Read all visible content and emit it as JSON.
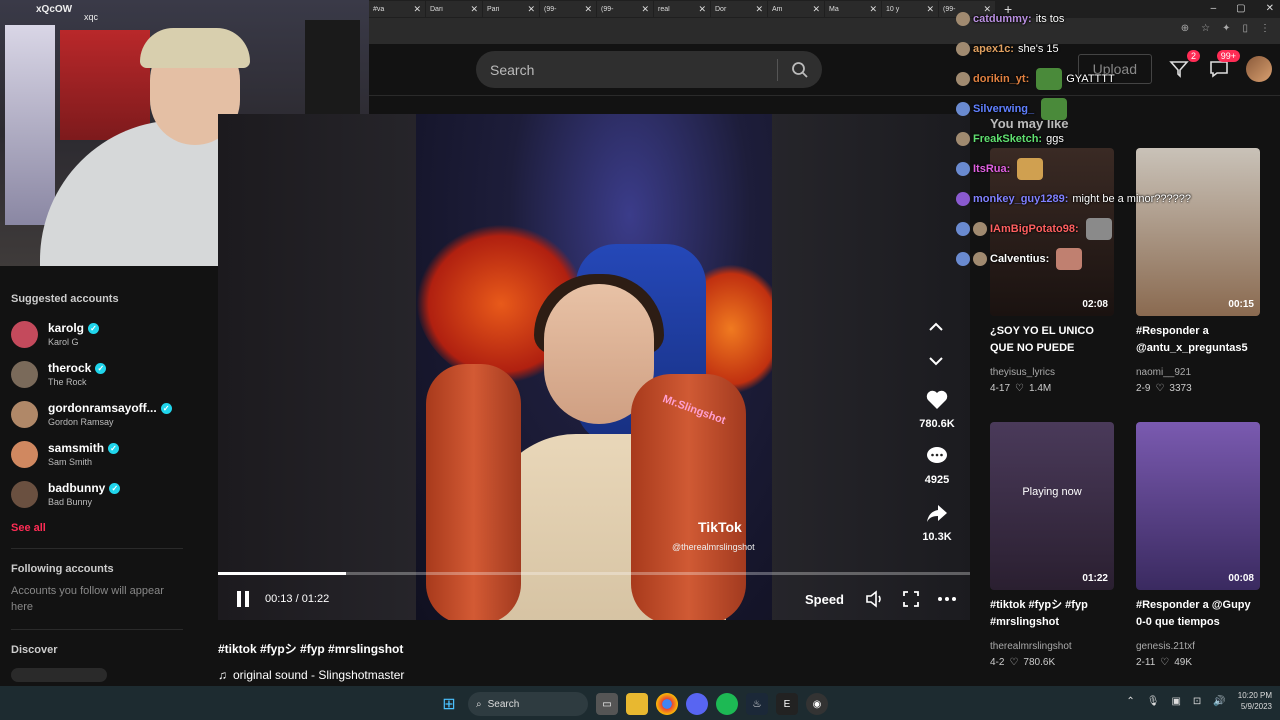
{
  "browser": {
    "tabs": [
      "#va",
      "Dari",
      "Pari",
      "(99-",
      "(99-",
      "real",
      "Dor",
      "Am",
      "Ma",
      "10 y",
      "(99-"
    ],
    "tab_close": "✕",
    "new_tab": "+",
    "window_controls": [
      "–",
      "▢",
      "✕"
    ]
  },
  "webcam": {
    "overlay_text_1": "xQcOW",
    "overlay_text_2": "xqc"
  },
  "header": {
    "search_placeholder": "Search",
    "upload_label": "Upload",
    "inbox_badge": "2",
    "messages_badge": "99+"
  },
  "sidebar": {
    "suggested_title": "Suggested accounts",
    "accounts": [
      {
        "handle": "karolg",
        "name": "Karol G",
        "color": "#c44a5c"
      },
      {
        "handle": "therock",
        "name": "The Rock",
        "color": "#7a6a5a"
      },
      {
        "handle": "gordonramsayoff...",
        "name": "Gordon Ramsay",
        "color": "#b08868"
      },
      {
        "handle": "samsmith",
        "name": "Sam Smith",
        "color": "#d08860"
      },
      {
        "handle": "badbunny",
        "name": "Bad Bunny",
        "color": "#6a5040"
      }
    ],
    "see_all": "See all",
    "following_title": "Following accounts",
    "following_text": "Accounts you follow will appear here",
    "discover_title": "Discover"
  },
  "video": {
    "watermark_name": "Mr.Slingshot",
    "tiktok_watermark": "TikTok",
    "watermark_handle": "@therealmrslingshot",
    "likes": "780.6K",
    "comments": "4925",
    "shares": "10.3K",
    "time": "00:13 / 01:22",
    "progress": 0.17,
    "speed_label": "Speed",
    "caption": "#tiktok #fypシ #fyp #mrslingshot",
    "sound": "original sound - Slingshotmaster"
  },
  "you_may_like": {
    "title": "You may like",
    "cards": [
      {
        "title": "¿SOY YO EL UNICO QUE NO PUEDE DEJAR DE...",
        "author": "theyisus_lyrics",
        "date": "4-17",
        "likes": "1.4M",
        "duration": "02:08",
        "playing": "",
        "color1": "#3a2a24",
        "color2": "#1a1210"
      },
      {
        "title": "#Responder a @antu_x_preguntas5",
        "author": "naomi__921",
        "date": "2-9",
        "likes": "3373",
        "duration": "00:15",
        "playing": "",
        "color1": "#c9c2b8",
        "color2": "#8a6a50"
      },
      {
        "title": "#tiktok #fypシ #fyp #mrslingshot",
        "author": "therealmrslingshot",
        "date": "4-2",
        "likes": "780.6K",
        "duration": "01:22",
        "playing": "Playing now",
        "color1": "#4a3a5a",
        "color2": "#2a1f30"
      },
      {
        "title": "#Responder a @Gupy 0-0 que tiempos",
        "author": "genesis.21txf",
        "date": "2-11",
        "likes": "49K",
        "duration": "00:08",
        "playing": "",
        "color1": "#7a5ab0",
        "color2": "#3a2a60"
      }
    ]
  },
  "chat": [
    {
      "user": "catdummy:",
      "msg": "its tos",
      "color": "#b98fe0"
    },
    {
      "user": "apex1c:",
      "msg": "she's 15",
      "color": "#e0a060"
    },
    {
      "user": "dorikin_yt:",
      "msg": "GYATTTT",
      "color": "#e08040"
    },
    {
      "user": "Silverwing_",
      "msg": "",
      "color": "#6080ff"
    },
    {
      "user": "FreakSketch:",
      "msg": "ggs",
      "color": "#60e070"
    },
    {
      "user": "ItsRua:",
      "msg": "",
      "color": "#e060e0"
    },
    {
      "user": "monkey_guy1289:",
      "msg": "might be a minor??????",
      "color": "#8080ff"
    },
    {
      "user": "IAmBigPotato98:",
      "msg": "",
      "color": "#ff6060"
    },
    {
      "user": "Calventius:",
      "msg": "",
      "color": "#ffffff"
    }
  ],
  "taskbar": {
    "search_label": "Search",
    "time": "10:20 PM",
    "date": "5/9/2023"
  }
}
